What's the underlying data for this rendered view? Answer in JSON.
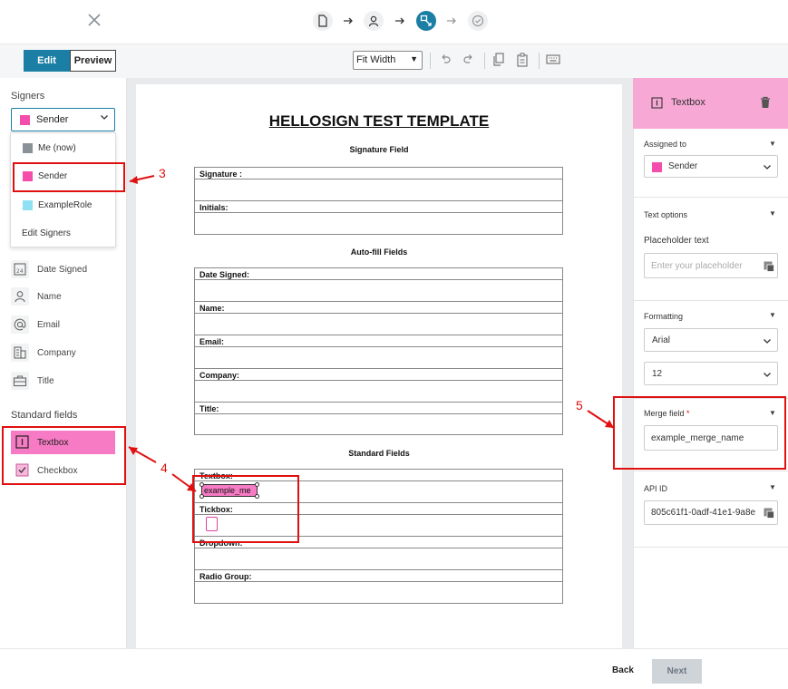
{
  "header": {
    "close_icon": "close-icon",
    "steps": [
      "document-icon",
      "person-icon",
      "place-fields-icon",
      "check-circle-icon"
    ],
    "active_step": 2
  },
  "toolbar": {
    "edit_label": "Edit",
    "preview_label": "Preview",
    "zoom_value": "Fit Width",
    "icons": [
      "undo-icon",
      "redo-icon",
      "copy-icon",
      "paste-icon",
      "keyboard-icon"
    ]
  },
  "sidebar": {
    "signers_heading": "Signers",
    "selected_signer": "Sender",
    "dropdown_items": [
      {
        "label": "Me (now)",
        "color": "#8a9299"
      },
      {
        "label": "Sender",
        "color": "#f54dac"
      },
      {
        "label": "ExampleRole",
        "color": "#8fe0f2"
      },
      {
        "label": "Edit Signers",
        "color": ""
      }
    ],
    "autofill_items": [
      {
        "label": "Date Signed",
        "icon": "calendar-icon"
      },
      {
        "label": "Name",
        "icon": "person-icon"
      },
      {
        "label": "Email",
        "icon": "at-icon"
      },
      {
        "label": "Company",
        "icon": "building-icon"
      },
      {
        "label": "Title",
        "icon": "briefcase-icon"
      }
    ],
    "standard_heading": "Standard fields",
    "standard_items": [
      {
        "label": "Textbox",
        "icon": "textbox-icon"
      },
      {
        "label": "Checkbox",
        "icon": "checkbox-icon"
      }
    ]
  },
  "document": {
    "title": "HELLOSIGN TEST TEMPLATE",
    "section_signature": "Signature Field",
    "signature_rows": [
      "Signature :",
      "Initials:"
    ],
    "section_autofill": "Auto-fill Fields",
    "autofill_rows": [
      "Date Signed:",
      "Name:",
      "Email:",
      "Company:",
      "Title:"
    ],
    "section_standard": "Standard Fields",
    "standard_rows": [
      "Textbox:",
      "Tickbox:",
      "Dropdown:",
      "Radio Group:"
    ],
    "placed_textbox_value": "example_me"
  },
  "right_panel": {
    "title": "Textbox",
    "assigned_to_label": "Assigned to",
    "assigned_to_value": "Sender",
    "text_options_label": "Text options",
    "placeholder_label": "Placeholder text",
    "placeholder_hint": "Enter your placeholder",
    "formatting_label": "Formatting",
    "font_value": "Arial",
    "size_value": "12",
    "merge_field_label": "Merge field",
    "merge_field_required": "*",
    "merge_field_value": "example_merge_name",
    "api_id_label": "API ID",
    "api_id_value": "805c61f1-0adf-41e1-9a8e"
  },
  "footer": {
    "back_label": "Back",
    "next_label": "Next"
  },
  "annotations": [
    "3",
    "4",
    "5"
  ],
  "colors": {
    "accent": "#1a7ea5",
    "sender_pink": "#f54dac",
    "active_field": "#f77bc4",
    "annotation_red": "#e01010"
  }
}
